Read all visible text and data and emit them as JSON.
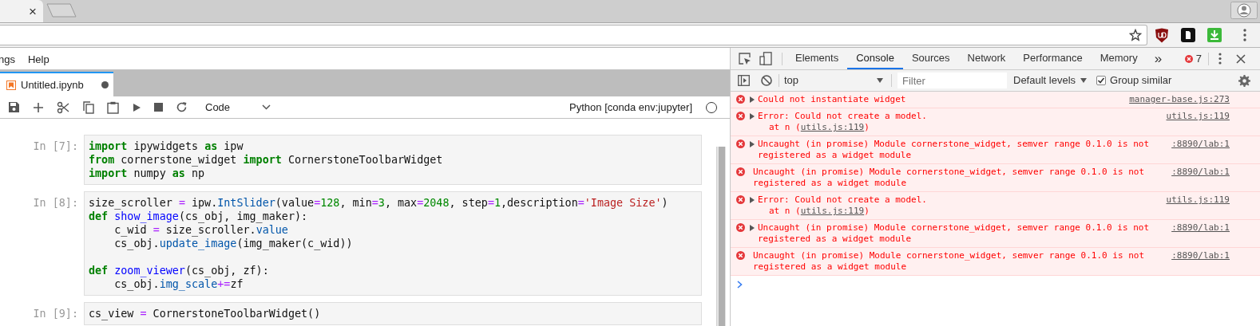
{
  "browser": {
    "tab_close": "×"
  },
  "jupyter": {
    "menu": [
      {
        "label": "ngs"
      },
      {
        "label": "Help"
      }
    ],
    "notebook_tab": {
      "title": "Untitled.ipynb",
      "unsaved": true
    },
    "toolbar": {
      "cell_type": "Code",
      "kernel": "Python [conda env:jupyter]",
      "kernel_busy": false
    },
    "cells": [
      {
        "prompt": "In [7]:",
        "lines": [
          {
            "kind": "code",
            "tokens": [
              {
                "text": "import",
                "kind": "kw"
              },
              {
                "text": " ipywidgets ",
                "kind": "plain"
              },
              {
                "text": "as",
                "kind": "kw"
              },
              {
                "text": " ipw",
                "kind": "plain"
              }
            ]
          },
          {
            "kind": "code",
            "tokens": [
              {
                "text": "from",
                "kind": "kw"
              },
              {
                "text": " cornerstone_widget ",
                "kind": "plain"
              },
              {
                "text": "import",
                "kind": "kw"
              },
              {
                "text": " CornerstoneToolbarWidget",
                "kind": "plain"
              }
            ]
          },
          {
            "kind": "code",
            "tokens": [
              {
                "text": "import",
                "kind": "kw"
              },
              {
                "text": " numpy ",
                "kind": "plain"
              },
              {
                "text": "as",
                "kind": "kw"
              },
              {
                "text": " np",
                "kind": "plain"
              }
            ]
          }
        ]
      },
      {
        "prompt": "In [8]:",
        "lines": [
          {
            "kind": "code",
            "tokens": [
              {
                "text": "size_scroller ",
                "kind": "plain"
              },
              {
                "text": "=",
                "kind": "op"
              },
              {
                "text": " ipw.",
                "kind": "plain"
              },
              {
                "text": "IntSlider",
                "kind": "prop"
              },
              {
                "text": "(value",
                "kind": "plain"
              },
              {
                "text": "=",
                "kind": "op"
              },
              {
                "text": "128",
                "kind": "num"
              },
              {
                "text": ", min",
                "kind": "plain"
              },
              {
                "text": "=",
                "kind": "op"
              },
              {
                "text": "3",
                "kind": "num"
              },
              {
                "text": ", max",
                "kind": "plain"
              },
              {
                "text": "=",
                "kind": "op"
              },
              {
                "text": "2048",
                "kind": "num"
              },
              {
                "text": ", step",
                "kind": "plain"
              },
              {
                "text": "=",
                "kind": "op"
              },
              {
                "text": "1",
                "kind": "num"
              },
              {
                "text": ",description",
                "kind": "plain"
              },
              {
                "text": "=",
                "kind": "op"
              },
              {
                "text": "'Image Size'",
                "kind": "str"
              },
              {
                "text": ")",
                "kind": "plain"
              }
            ]
          },
          {
            "kind": "code",
            "tokens": [
              {
                "text": "def",
                "kind": "kw"
              },
              {
                "text": " show_image",
                "kind": "def"
              },
              {
                "text": "(cs_obj, img_maker):",
                "kind": "plain"
              }
            ]
          },
          {
            "kind": "code",
            "tokens": [
              {
                "text": "    c_wid ",
                "kind": "plain"
              },
              {
                "text": "=",
                "kind": "op"
              },
              {
                "text": " size_scroller.",
                "kind": "plain"
              },
              {
                "text": "value",
                "kind": "prop"
              }
            ]
          },
          {
            "kind": "code",
            "tokens": [
              {
                "text": "    cs_obj.",
                "kind": "plain"
              },
              {
                "text": "update_image",
                "kind": "prop"
              },
              {
                "text": "(img_maker(c_wid))",
                "kind": "plain"
              }
            ]
          },
          {
            "kind": "blank"
          },
          {
            "kind": "code",
            "tokens": [
              {
                "text": "def",
                "kind": "kw"
              },
              {
                "text": " zoom_viewer",
                "kind": "def"
              },
              {
                "text": "(cs_obj, zf):",
                "kind": "plain"
              }
            ]
          },
          {
            "kind": "code",
            "tokens": [
              {
                "text": "    cs_obj.",
                "kind": "plain"
              },
              {
                "text": "img_scale",
                "kind": "prop"
              },
              {
                "text": "+=",
                "kind": "op"
              },
              {
                "text": "zf",
                "kind": "plain"
              }
            ]
          }
        ]
      },
      {
        "prompt": "In [9]:",
        "lines": [
          {
            "kind": "code",
            "tokens": [
              {
                "text": "cs_view ",
                "kind": "plain"
              },
              {
                "text": "=",
                "kind": "op"
              },
              {
                "text": " CornerstoneToolbarWidget()",
                "kind": "plain"
              }
            ]
          }
        ]
      }
    ]
  },
  "devtools": {
    "tabs": [
      {
        "label": "Elements",
        "selected": false
      },
      {
        "label": "Console",
        "selected": true
      },
      {
        "label": "Sources",
        "selected": false
      },
      {
        "label": "Network",
        "selected": false
      },
      {
        "label": "Performance",
        "selected": false
      },
      {
        "label": "Memory",
        "selected": false
      }
    ],
    "more_tabs": "»",
    "error_count": "7",
    "console_toolbar": {
      "context": "top",
      "filter_placeholder": "Filter",
      "levels": "Default levels",
      "group_similar": {
        "label": "Group similar",
        "checked": true
      }
    },
    "messages": [
      {
        "expandable": true,
        "text": "Could not instantiate widget",
        "source": "manager-base.js:273"
      },
      {
        "expandable": true,
        "text": "Error: Could not create a model.",
        "detail": {
          "prefix": "at n (",
          "link": "utils.js:119",
          "suffix": ")"
        },
        "source": "utils.js:119"
      },
      {
        "expandable": true,
        "text": "Uncaught (in promise) Module cornerstone_widget, semver range 0.1.0 is not registered as a widget module",
        "source": ":8890/lab:1"
      },
      {
        "expandable": false,
        "text": "Uncaught (in promise) Module cornerstone_widget, semver range 0.1.0 is not registered as a widget module",
        "source": ":8890/lab:1"
      },
      {
        "expandable": true,
        "text": "Error: Could not create a model.",
        "detail": {
          "prefix": "at n (",
          "link": "utils.js:119",
          "suffix": ")"
        },
        "source": "utils.js:119"
      },
      {
        "expandable": true,
        "text": "Uncaught (in promise) Module cornerstone_widget, semver range 0.1.0 is not registered as a widget module",
        "source": ":8890/lab:1"
      },
      {
        "expandable": false,
        "text": "Uncaught (in promise) Module cornerstone_widget, semver range 0.1.0 is not registered as a widget module",
        "source": ":8890/lab:1"
      }
    ]
  }
}
